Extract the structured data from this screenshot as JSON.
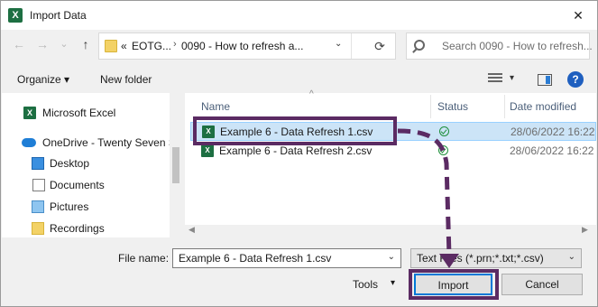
{
  "window": {
    "title": "Import Data",
    "close_glyph": "✕",
    "app_icon_letter": "X"
  },
  "address": {
    "prefix": "«",
    "segment1": "EOTG...",
    "segment2": "0090 - How to refresh a...",
    "chevron": "›",
    "dropdown": "⌄",
    "refresh": "⟳"
  },
  "nav_arrows": {
    "back": "←",
    "forward": "→",
    "dropdown": "⌄",
    "up": "↑"
  },
  "search": {
    "placeholder": "Search 0090 - How to refresh..."
  },
  "toolbar": {
    "organize": "Organize ▾",
    "new_folder": "New folder",
    "help": "?"
  },
  "nav_pane": {
    "items": [
      {
        "label": "Microsoft Excel",
        "icon": "excel-icon"
      },
      {
        "label": "OneDrive - Twenty Seven S",
        "icon": "cloud-icon"
      },
      {
        "label": "Desktop",
        "icon": "desktop-icon"
      },
      {
        "label": "Documents",
        "icon": "documents-icon"
      },
      {
        "label": "Pictures",
        "icon": "pictures-icon"
      },
      {
        "label": "Recordings",
        "icon": "folder-icon"
      }
    ]
  },
  "file_list": {
    "columns": {
      "name": "Name",
      "status": "Status",
      "date": "Date modified"
    },
    "sort_glyph": "^",
    "files": [
      {
        "name": "Example 6 - Data Refresh 1.csv",
        "date": "28/06/2022 16:22",
        "selected": true,
        "icon_text": "X"
      },
      {
        "name": "Example 6 - Data Refresh 2.csv",
        "date": "28/06/2022 16:22",
        "selected": false,
        "icon_text": "X"
      }
    ]
  },
  "bottom": {
    "file_name_label": "File name:",
    "file_name_value": "Example 6 - Data Refresh 1.csv",
    "filter_value": "Text Files (*.prn;*.txt;*.csv)",
    "tools_label": "Tools",
    "tools_dd": "▾",
    "import_label": "Import",
    "cancel_label": "Cancel"
  },
  "colors": {
    "highlight": "#5b2b63",
    "selection": "#cce4f7",
    "excel_green": "#1d6f42"
  }
}
